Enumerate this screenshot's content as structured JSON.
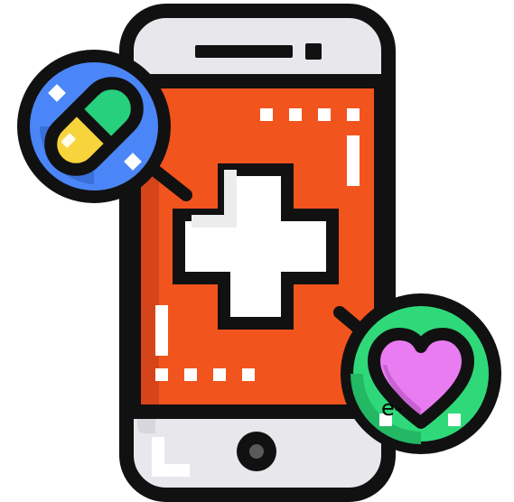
{
  "edge_text": "e-",
  "illustration": {
    "icons": [
      "smartphone-icon",
      "medical-cross-icon",
      "pill-capsule-icon",
      "heart-icon",
      "home-button-icon"
    ]
  },
  "colors": {
    "outline": "#111111",
    "phone_body": "#e8e8ec",
    "phone_screen": "#f2541d",
    "screen_shadow": "#d6451a",
    "cross_fill": "#ffffff",
    "pill_badge": "#4a86f7",
    "pill_half_a": "#f7d43b",
    "pill_half_b": "#26d07c",
    "heart_badge": "#2fd97a",
    "heart_fill": "#ea7cf2",
    "sparkle": "#ffffff"
  }
}
